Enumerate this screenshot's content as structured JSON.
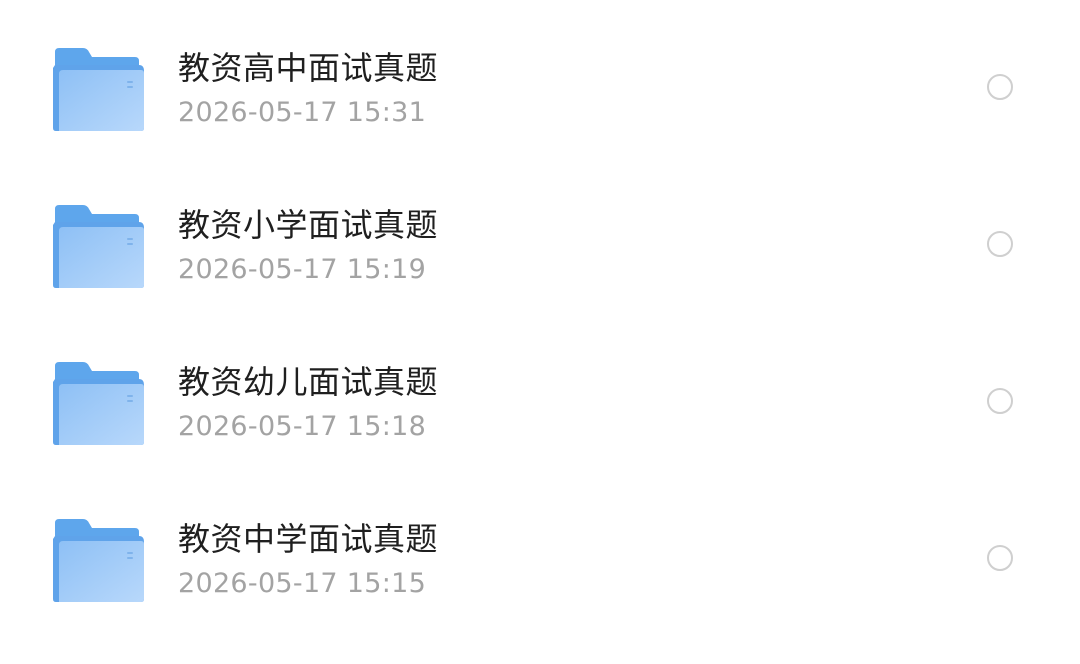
{
  "files": [
    {
      "name": "教资高中面试真题",
      "date": "2026-05-17 15:31",
      "icon": "folder-icon",
      "selected": false
    },
    {
      "name": "教资小学面试真题",
      "date": "2026-05-17 15:19",
      "icon": "folder-icon",
      "selected": false
    },
    {
      "name": "教资幼儿面试真题",
      "date": "2026-05-17 15:18",
      "icon": "folder-icon",
      "selected": false
    },
    {
      "name": "教资中学面试真题",
      "date": "2026-05-17 15:15",
      "icon": "folder-icon",
      "selected": false
    }
  ],
  "colors": {
    "folder_back": "#5ea6ec",
    "folder_front_top": "#8ec0f5",
    "folder_front_bottom": "#b5d6fa",
    "title_text": "#1f1f1f",
    "date_text": "#a3a3a3",
    "radio_border": "#cfcfcf"
  }
}
